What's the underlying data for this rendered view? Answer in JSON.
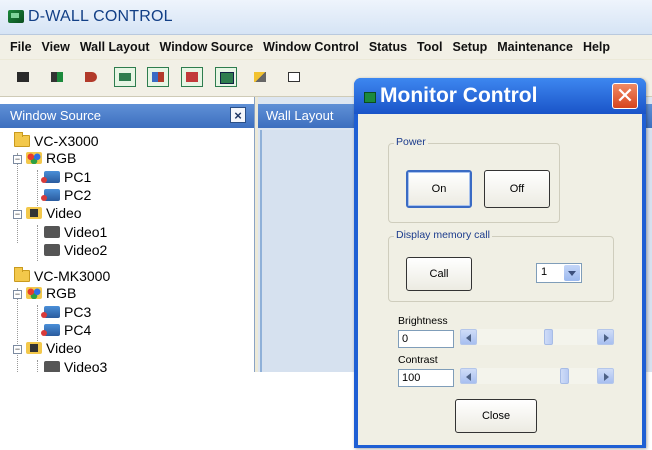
{
  "app": {
    "title": "D-WALL CONTROL"
  },
  "menu": [
    "File",
    "View",
    "Wall Layout",
    "Window Source",
    "Window Control",
    "Status",
    "Tool",
    "Setup",
    "Maintenance",
    "Help"
  ],
  "toolbar": {
    "icons": [
      "monitor-icon",
      "layout-icon",
      "source-icon",
      "window-icon",
      "wall-icon",
      "display-icon",
      "grid-icon",
      "pointer-icon",
      "info-icon"
    ]
  },
  "window_source": {
    "title": "Window Source",
    "close_label": "×",
    "tree": [
      {
        "label": "VC-X3000",
        "kind": "controller"
      },
      {
        "label": "RGB",
        "kind": "group"
      },
      {
        "label": "PC1",
        "kind": "input"
      },
      {
        "label": "PC2",
        "kind": "input"
      },
      {
        "label": "Video",
        "kind": "group"
      },
      {
        "label": "Video1",
        "kind": "input"
      },
      {
        "label": "Video2",
        "kind": "input"
      },
      {
        "label": "VC-MK3000",
        "kind": "controller"
      },
      {
        "label": "RGB",
        "kind": "group"
      },
      {
        "label": "PC3",
        "kind": "input"
      },
      {
        "label": "PC4",
        "kind": "input"
      },
      {
        "label": "Video",
        "kind": "group"
      },
      {
        "label": "Video3",
        "kind": "input"
      }
    ]
  },
  "wall_layout": {
    "title": "Wall Layout"
  },
  "dialog": {
    "title": "Monitor Control",
    "close_label": "✕",
    "power": {
      "title": "Power",
      "on_label": "On",
      "off_label": "Off"
    },
    "memory": {
      "title": "Display memory call",
      "call_label": "Call",
      "selected": "1"
    },
    "brightness": {
      "label": "Brightness",
      "value": "0",
      "slider_fraction": 0.6
    },
    "contrast": {
      "label": "Contrast",
      "value": "100",
      "slider_fraction": 0.75
    },
    "close_button_label": "Close"
  },
  "colors": {
    "dialog_title": "#1f5fd4",
    "panel_header": "#4a7dcc",
    "close_red": "#d6441e"
  }
}
